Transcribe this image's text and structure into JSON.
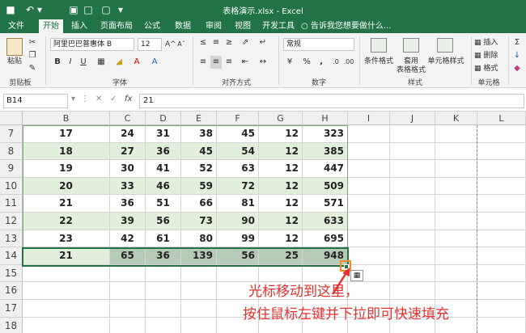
{
  "titlebar": {
    "title": "表格演示.xlsx - Excel",
    "quick_access": [
      "■",
      "↶",
      "▾",
      "▣",
      "□",
      "▢",
      "▾"
    ]
  },
  "tabs": [
    "文件",
    "开始",
    "插入",
    "页面布局",
    "公式",
    "数据",
    "审阅",
    "视图",
    "开发工具"
  ],
  "tell_me": "告诉我您想要做什么...",
  "ribbon": {
    "clipboard": {
      "paste": "粘贴",
      "label": "剪贴板"
    },
    "font": {
      "name": "阿里巴巴普惠体 B",
      "size": "12",
      "label": "字体",
      "buttons": [
        "B",
        "I",
        "U",
        "A",
        "A"
      ]
    },
    "alignment": {
      "label": "对齐方式"
    },
    "number": {
      "format": "常规",
      "label": "数字",
      "buttons": [
        "%",
        ","
      ]
    },
    "styles": {
      "label": "样式",
      "items": [
        "条件格式",
        "套用\n表格格式",
        "单元格样式"
      ]
    },
    "cells": {
      "label": "单元格",
      "items": [
        "插入",
        "删除",
        "格式"
      ]
    }
  },
  "formula_bar": {
    "name_box": "B14",
    "fx_label": "fx",
    "value": "21"
  },
  "columns": [
    "B",
    "C",
    "D",
    "E",
    "F",
    "G",
    "H",
    "I",
    "J",
    "K",
    "L"
  ],
  "rows": [
    {
      "num": "7",
      "cells": [
        "17",
        "24",
        "31",
        "38",
        "45",
        "12",
        "323"
      ]
    },
    {
      "num": "8",
      "cells": [
        "18",
        "27",
        "36",
        "45",
        "54",
        "12",
        "385"
      ]
    },
    {
      "num": "9",
      "cells": [
        "19",
        "30",
        "41",
        "52",
        "63",
        "12",
        "447"
      ]
    },
    {
      "num": "10",
      "cells": [
        "20",
        "33",
        "46",
        "59",
        "72",
        "12",
        "509"
      ]
    },
    {
      "num": "11",
      "cells": [
        "21",
        "36",
        "51",
        "66",
        "81",
        "12",
        "571"
      ]
    },
    {
      "num": "12",
      "cells": [
        "22",
        "39",
        "56",
        "73",
        "90",
        "12",
        "633"
      ]
    },
    {
      "num": "13",
      "cells": [
        "23",
        "42",
        "61",
        "80",
        "99",
        "12",
        "695"
      ]
    },
    {
      "num": "14",
      "cells": [
        "21",
        "65",
        "36",
        "139",
        "56",
        "25",
        "948"
      ]
    },
    {
      "num": "15",
      "cells": []
    },
    {
      "num": "16",
      "cells": []
    },
    {
      "num": "17",
      "cells": []
    },
    {
      "num": "18",
      "cells": []
    }
  ],
  "annotation": {
    "line1": "光标移动到这里，",
    "line2": "按住鼠标左键并下拉即可快速填充"
  },
  "colors": {
    "accent": "#217346",
    "annotation": "#e53030",
    "band": "#e2efda",
    "selection": "#b5cbb5",
    "handle_box": "#f08a24"
  }
}
